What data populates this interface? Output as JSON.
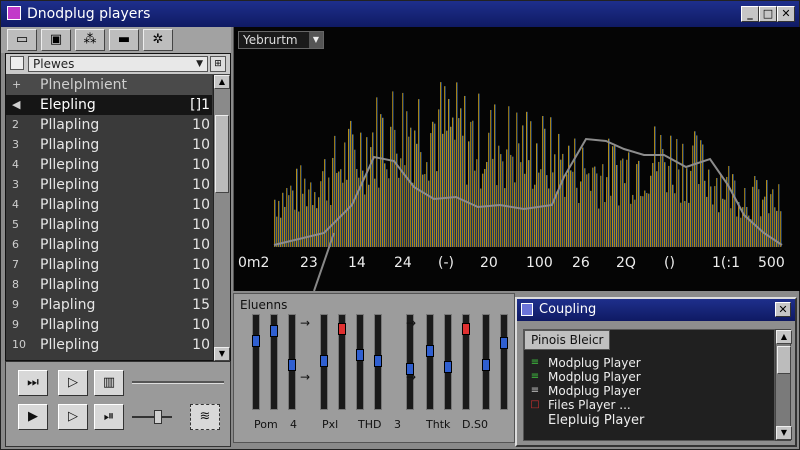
{
  "window": {
    "title": "Dnodplug players",
    "minimize": "_",
    "maximize": "□",
    "close": "✕"
  },
  "toolbar": {
    "buttons": [
      "folder-icon",
      "save-icon",
      "dots-icon",
      "monitor-icon",
      "snowflake-icon"
    ]
  },
  "playlist": {
    "selector_value": "Plewes",
    "header": {
      "mark": "+",
      "name": "Plnelplmient"
    },
    "rows": [
      {
        "idx": "◀",
        "name": "Elepling",
        "len": "[]1",
        "selected": true
      },
      {
        "idx": "2",
        "name": "Pllapling",
        "len": "10"
      },
      {
        "idx": "3",
        "name": "Pllapling",
        "len": "10"
      },
      {
        "idx": "4",
        "name": "Pllepling",
        "len": "10"
      },
      {
        "idx": "3",
        "name": "Pllepling",
        "len": "10"
      },
      {
        "idx": "4",
        "name": "Pllapling",
        "len": "10"
      },
      {
        "idx": "5",
        "name": "Pllapling",
        "len": "10"
      },
      {
        "idx": "6",
        "name": "Pllapling",
        "len": "10"
      },
      {
        "idx": "7",
        "name": "Pllapling",
        "len": "10"
      },
      {
        "idx": "8",
        "name": "Pllapling",
        "len": "10"
      },
      {
        "idx": "9",
        "name": "Plapling",
        "len": "15"
      },
      {
        "idx": "9",
        "name": "Pllapling",
        "len": "10"
      },
      {
        "idx": "10",
        "name": "Pllepling",
        "len": "10"
      }
    ]
  },
  "transport": {
    "row1": [
      "skip-icon",
      "play-icon",
      "equalizer-icon"
    ],
    "row2": [
      "play-icon",
      "play-outline-icon",
      "next-icon"
    ],
    "extra": "≋",
    "volume_level": 0.55
  },
  "visualizer": {
    "label": "Yebrurtm",
    "axis_labels": [
      "0m2",
      "23",
      "14",
      "24",
      "(-)",
      "20",
      "100",
      "26",
      "2Q",
      "()",
      "1(:1",
      "500"
    ]
  },
  "mixer": {
    "title": "Eluenns",
    "channel_labels": [
      "Pom",
      "4",
      "Pxl",
      "THD",
      "3",
      "Thtk",
      "D.S0"
    ],
    "arrows": [
      "→",
      "→",
      "→",
      "→",
      "→",
      "→",
      "−"
    ]
  },
  "dialog": {
    "title": "Coupling",
    "close": "✕",
    "list_header": "Pinois Bleicr",
    "items": [
      {
        "label": "Modplug Player",
        "mark": "≡",
        "color": "#3ec23e"
      },
      {
        "label": "Modplug Player",
        "mark": "≡",
        "color": "#3ec23e"
      },
      {
        "label": "Modplug Player",
        "mark": "≡",
        "color": "#c6c6c6"
      },
      {
        "label": "Files Player ...",
        "mark": "□",
        "color": "#d03030"
      },
      {
        "label": "Elepluig Player",
        "mark": "",
        "color": "#ffffff"
      }
    ]
  },
  "colors": {
    "titlebar": "#0f1a63",
    "accent_red": "#e03030",
    "accent_blue": "#2f5fd0"
  }
}
